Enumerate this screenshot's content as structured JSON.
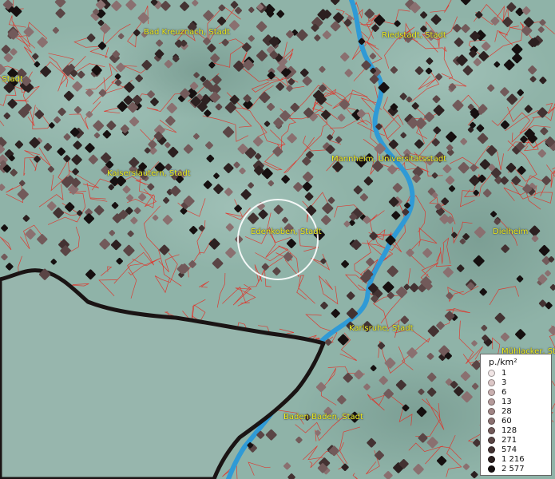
{
  "map": {
    "cities": [
      {
        "id": "bad-kreuznach",
        "name": "Bad Kreuznach, Stadt"
      },
      {
        "id": "riedstadt",
        "name": "Riedstadt, Stadt"
      },
      {
        "id": "left-edge",
        "name": ", Stadt"
      },
      {
        "id": "kaiserslautern",
        "name": "Kaiserslautern, Stadt"
      },
      {
        "id": "mannheim",
        "name": "Mannheim, Universitätsstadt"
      },
      {
        "id": "edenkoben",
        "name": "Edenkoben, Stadt"
      },
      {
        "id": "dielheim",
        "name": "Dielheim"
      },
      {
        "id": "karlsruhe",
        "name": "Karlsruhe, Stadt"
      },
      {
        "id": "muehlacker",
        "name": "Mühlacker, Stadt"
      },
      {
        "id": "baden-baden",
        "name": "Baden-Baden, Stadt"
      }
    ],
    "colors": {
      "terrain": "#8fb3a8",
      "boundary": "#e8281e",
      "river": "#2f9ad6",
      "label": "#f2f21a",
      "border_dark": "#1a1414"
    }
  },
  "legend": {
    "title": "p./km²",
    "items": [
      {
        "label": "1",
        "color": "#f1e6e6"
      },
      {
        "label": "3",
        "color": "#dcc7c7"
      },
      {
        "label": "6",
        "color": "#c9b0b0"
      },
      {
        "label": "13",
        "color": "#b59b9b"
      },
      {
        "label": "28",
        "color": "#a08585"
      },
      {
        "label": "60",
        "color": "#8a7070"
      },
      {
        "label": "128",
        "color": "#725a5a"
      },
      {
        "label": "271",
        "color": "#5a4545"
      },
      {
        "label": "574",
        "color": "#433232"
      },
      {
        "label": "1 216",
        "color": "#2c2020"
      },
      {
        "label": "2 577",
        "color": "#161010"
      }
    ]
  }
}
